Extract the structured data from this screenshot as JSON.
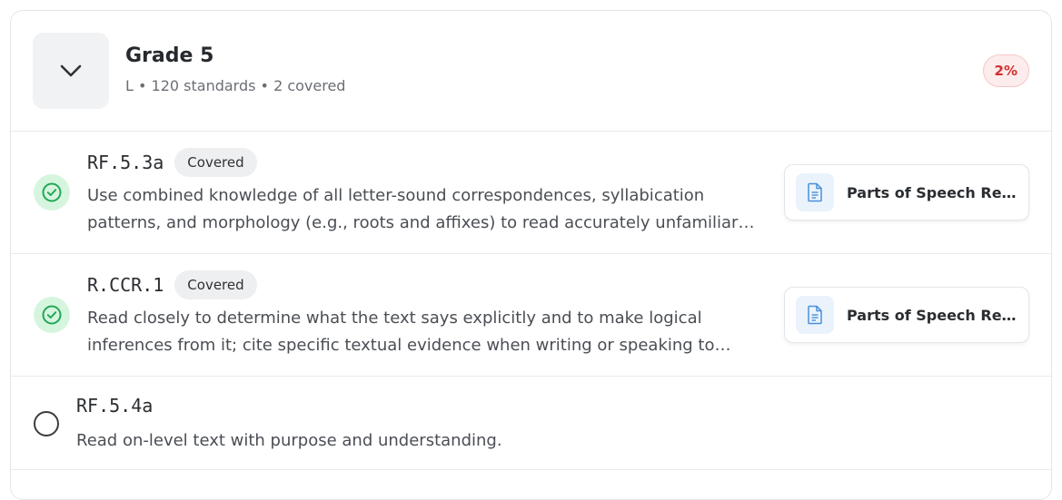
{
  "grade": {
    "title": "Grade 5",
    "meta": "L • 120 standards • 2 covered",
    "coverage_percent": "2%"
  },
  "colors": {
    "badge_red": "#d0302f",
    "covered_green": "#22a855",
    "doc_blue": "#4a90d9"
  },
  "standards": [
    {
      "code": "RF.5.3a",
      "status": "covered",
      "status_label": "Covered",
      "description": "Use combined knowledge of all letter-sound correspondences, syllabication patterns, and morphology (e.g., roots and affixes) to read accurately unfamiliar multisyllabic words in context and out of context.",
      "linked_doc": {
        "title": "Parts of Speech Review",
        "icon": "document-icon"
      }
    },
    {
      "code": "R.CCR.1",
      "status": "covered",
      "status_label": "Covered",
      "description": "Read closely to determine what the text says explicitly and to make logical inferences from it; cite specific textual evidence when writing or speaking to support conclusions drawn from the text.",
      "linked_doc": {
        "title": "Parts of Speech Review",
        "icon": "document-icon"
      }
    },
    {
      "code": "RF.5.4a",
      "status": "uncovered",
      "description": "Read on-level text with purpose and understanding."
    }
  ],
  "icons": {
    "toggle": "chevron-down-icon",
    "covered": "check-circle-icon",
    "uncovered": "empty-circle-icon"
  }
}
